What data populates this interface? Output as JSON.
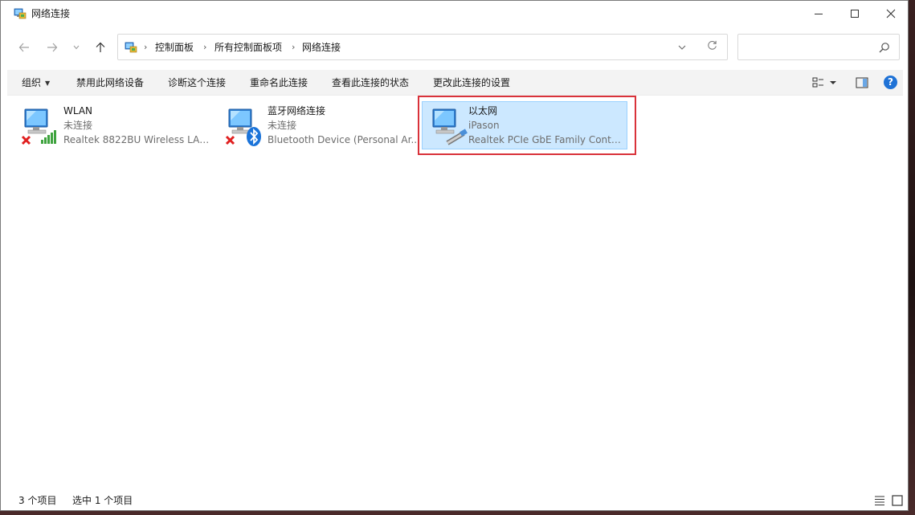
{
  "window": {
    "title": "网络连接"
  },
  "nav": {
    "back_icon": "arrow-left",
    "forward_icon": "arrow-right",
    "recent_icon": "chevron-down",
    "up_icon": "arrow-up"
  },
  "address": {
    "crumbs": [
      "控制面板",
      "所有控制面板项",
      "网络连接"
    ],
    "separator": "›"
  },
  "search": {
    "placeholder": ""
  },
  "commands": {
    "organize": "组织",
    "disable": "禁用此网络设备",
    "diagnose": "诊断这个连接",
    "rename": "重命名此连接",
    "view_status": "查看此连接的状态",
    "change_settings": "更改此连接的设置",
    "help": "?"
  },
  "connections": [
    {
      "name": "WLAN",
      "status": "未连接",
      "device": "Realtek 8822BU Wireless LAN ...",
      "badge": "signal-bars",
      "disconnected": true
    },
    {
      "name": "蓝牙网络连接",
      "status": "未连接",
      "device": "Bluetooth Device (Personal Ar...",
      "badge": "bluetooth",
      "disconnected": true
    },
    {
      "name": "以太网",
      "status": "iPason",
      "device": "Realtek PCIe GbE Family Contr...",
      "badge": "ethernet-cable",
      "disconnected": false,
      "selected": true
    }
  ],
  "statusbar": {
    "count": "3 个项目",
    "selection": "选中 1 个项目"
  },
  "colors": {
    "accent": "#1f72d6",
    "selection_bg": "#cce8ff",
    "highlight_border": "#d9323a"
  }
}
